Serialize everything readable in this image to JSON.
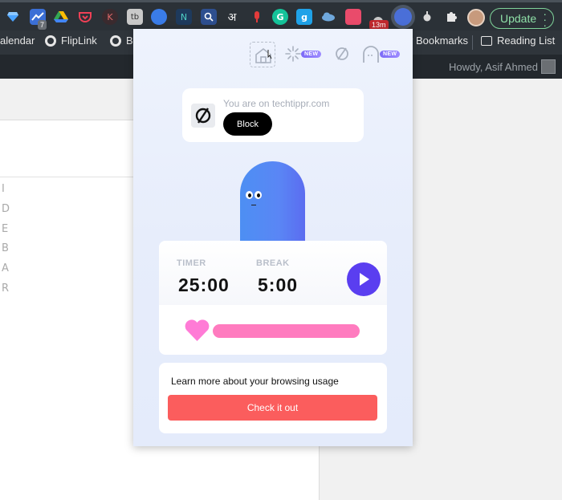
{
  "browser": {
    "update_label": "Update",
    "ext_badges": {
      "b1": "7",
      "b2": "13m"
    },
    "ext_letters": {
      "k": "K",
      "tb": "tb",
      "n": "N",
      "hindi": "अ",
      "g": "G",
      "g2": "g"
    }
  },
  "bookmarks": [
    {
      "label": "alendar"
    },
    {
      "label": "FlipLink"
    },
    {
      "label": "B"
    },
    {
      "label": "r Bookmarks"
    },
    {
      "label": "Reading List"
    }
  ],
  "wp": {
    "howdy": "Howdy, Asif Ahmed"
  },
  "page": {
    "letters": "I\nD\nE\nB\nA\nR"
  },
  "popup": {
    "nav": {
      "new_badge_1": "NEW",
      "new_badge_2": "NEW"
    },
    "site": {
      "text": "You are on techtippr.com",
      "block_label": "Block"
    },
    "timer": {
      "timer_label": "TIMER",
      "timer_value": "25:00",
      "break_label": "BREAK",
      "break_value": "5:00"
    },
    "info": {
      "text": "Learn more about your browsing usage",
      "button_label": "Check it out"
    }
  },
  "colors": {
    "accent_purple": "#5a3ef0",
    "progress_pink": "#ff7bbf",
    "cta_red": "#fb5d5d",
    "ghost_blue": "#4d8ff3",
    "update_green": "#8fe0a8"
  }
}
